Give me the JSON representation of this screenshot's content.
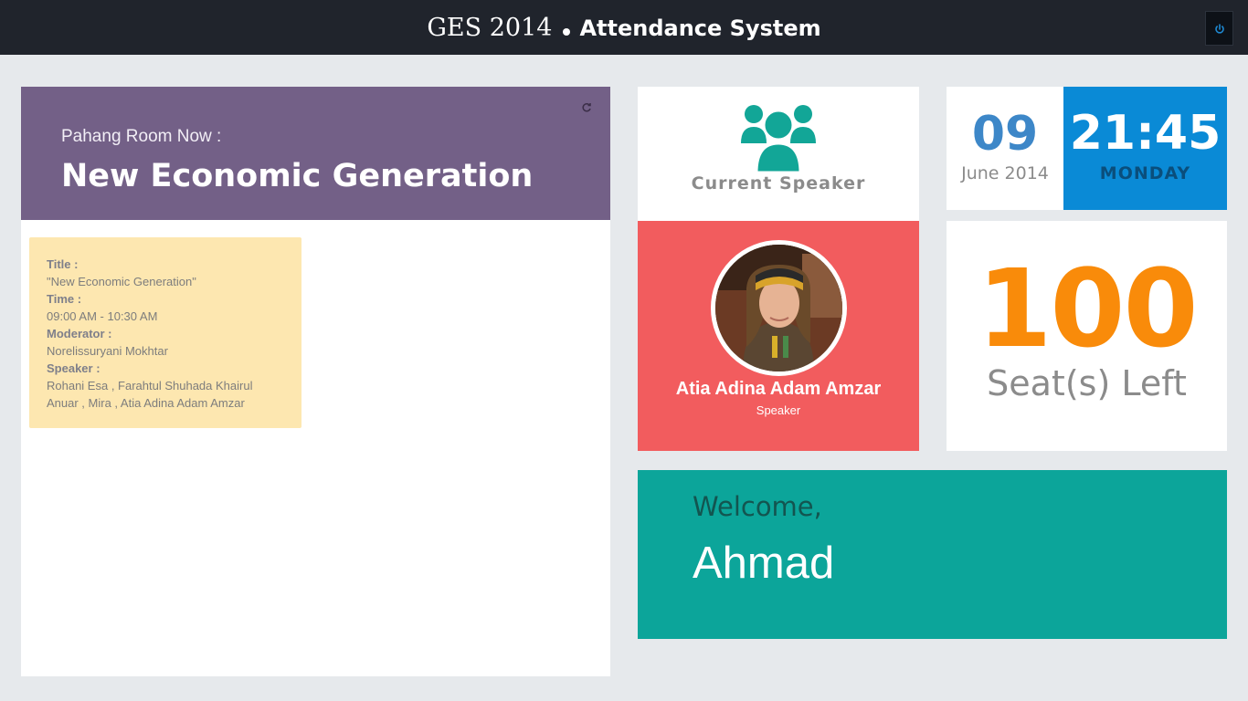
{
  "header": {
    "title_light": "GES 2014",
    "title_bold": "Attendance System",
    "power_icon": "power-icon"
  },
  "room": {
    "label": "Pahang Room Now :",
    "title": "New Economic Generation",
    "refresh_icon": "refresh-icon",
    "color": "#736087"
  },
  "session": {
    "title_key": "Title :",
    "title_value": "\"New Economic Generation\"",
    "time_key": "Time :",
    "time_value": "09:00 AM - 10:30 AM",
    "moderator_key": "Moderator :",
    "moderator_value": "Norelissuryani Mokhtar",
    "speaker_key": "Speaker :",
    "speaker_value": "Rohani Esa , Farahtul Shuhada Khairul Anuar , Mira , Atia Adina Adam Amzar"
  },
  "current_speaker": {
    "label": "Current Speaker",
    "icon": "users-icon",
    "name": "Atia Adina Adam Amzar",
    "role": "Speaker",
    "color": "#f25c5e"
  },
  "date": {
    "day": "09",
    "month_year": "June 2014",
    "time": "21:45",
    "weekday": "MONDAY",
    "color": "#0a8ad6"
  },
  "seats": {
    "count": "100",
    "label": "Seat(s) Left",
    "color": "#f98b0a"
  },
  "welcome": {
    "label": "Welcome,",
    "name": "Ahmad",
    "color": "#0ca59a"
  }
}
